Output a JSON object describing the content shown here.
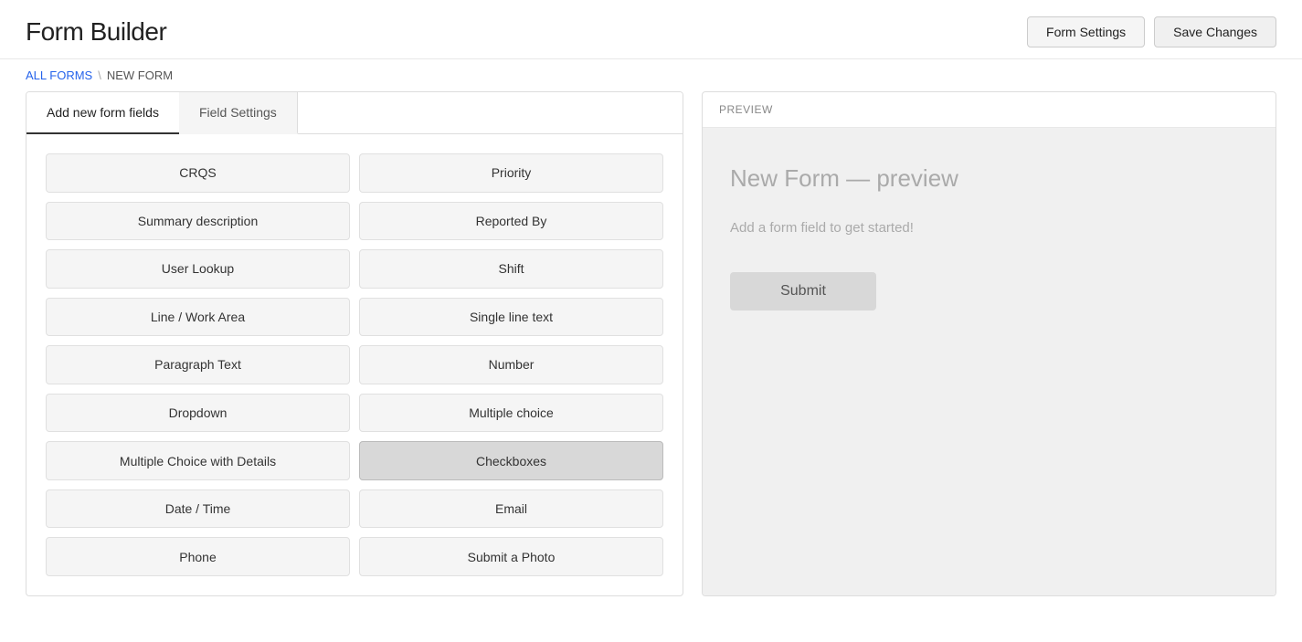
{
  "header": {
    "title": "Form Builder",
    "form_settings_label": "Form Settings",
    "save_changes_label": "Save Changes"
  },
  "breadcrumb": {
    "all_forms": "ALL FORMS",
    "separator": "\\",
    "current": "NEW FORM"
  },
  "tabs": {
    "add_fields": "Add new form fields",
    "field_settings": "Field Settings"
  },
  "left_fields": [
    "CRQS",
    "Summary description",
    "User Lookup",
    "Line / Work Area",
    "Paragraph Text",
    "Dropdown",
    "Multiple Choice with Details",
    "Date / Time",
    "Phone"
  ],
  "right_fields": [
    "Priority",
    "Reported By",
    "Shift",
    "Single line text",
    "Number",
    "Multiple choice",
    "Checkboxes",
    "Email",
    "Submit a Photo"
  ],
  "preview": {
    "label": "PREVIEW",
    "title": "New Form — preview",
    "empty_text": "Add a form field to get started!",
    "submit_label": "Submit"
  }
}
